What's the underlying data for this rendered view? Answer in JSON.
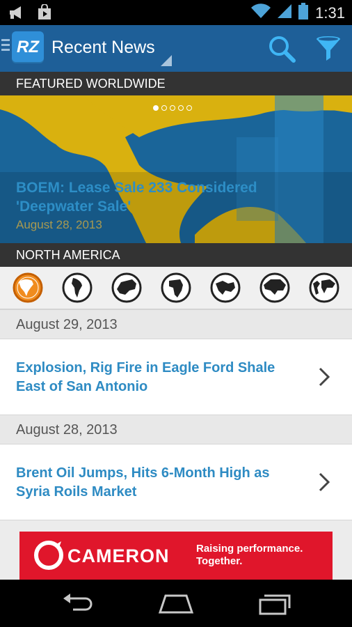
{
  "status_bar": {
    "time": "1:31"
  },
  "action_bar": {
    "logo_text": "RZ",
    "title": "Recent News"
  },
  "featured": {
    "header": "FEATURED WORLDWIDE",
    "page_count": 5,
    "active_page": 1,
    "title": "BOEM: Lease Sale 233 Considered 'Deepwater Sale'",
    "date": "August 28, 2013"
  },
  "region": {
    "header": "NORTH AMERICA",
    "icons": [
      "north-america-globe-icon",
      "south-america-globe-icon",
      "europe-globe-icon",
      "africa-globe-icon",
      "middle-east-globe-icon",
      "asia-globe-icon",
      "world-globe-icon"
    ],
    "active_index": 0,
    "active_color": "#f08c1e"
  },
  "news": [
    {
      "date": "August 29, 2013",
      "title": "Explosion, Rig Fire in Eagle Ford Shale East of San Antonio"
    },
    {
      "date": "August 28, 2013",
      "title": "Brent Oil Jumps, Hits 6-Month High as Syria Roils Market"
    }
  ],
  "ad": {
    "brand": "CAMERON",
    "tagline": "Raising performance. Together."
  },
  "colors": {
    "action_bar": "#1e5f98",
    "link": "#2e8bc3",
    "ad_red": "#e0162b"
  }
}
